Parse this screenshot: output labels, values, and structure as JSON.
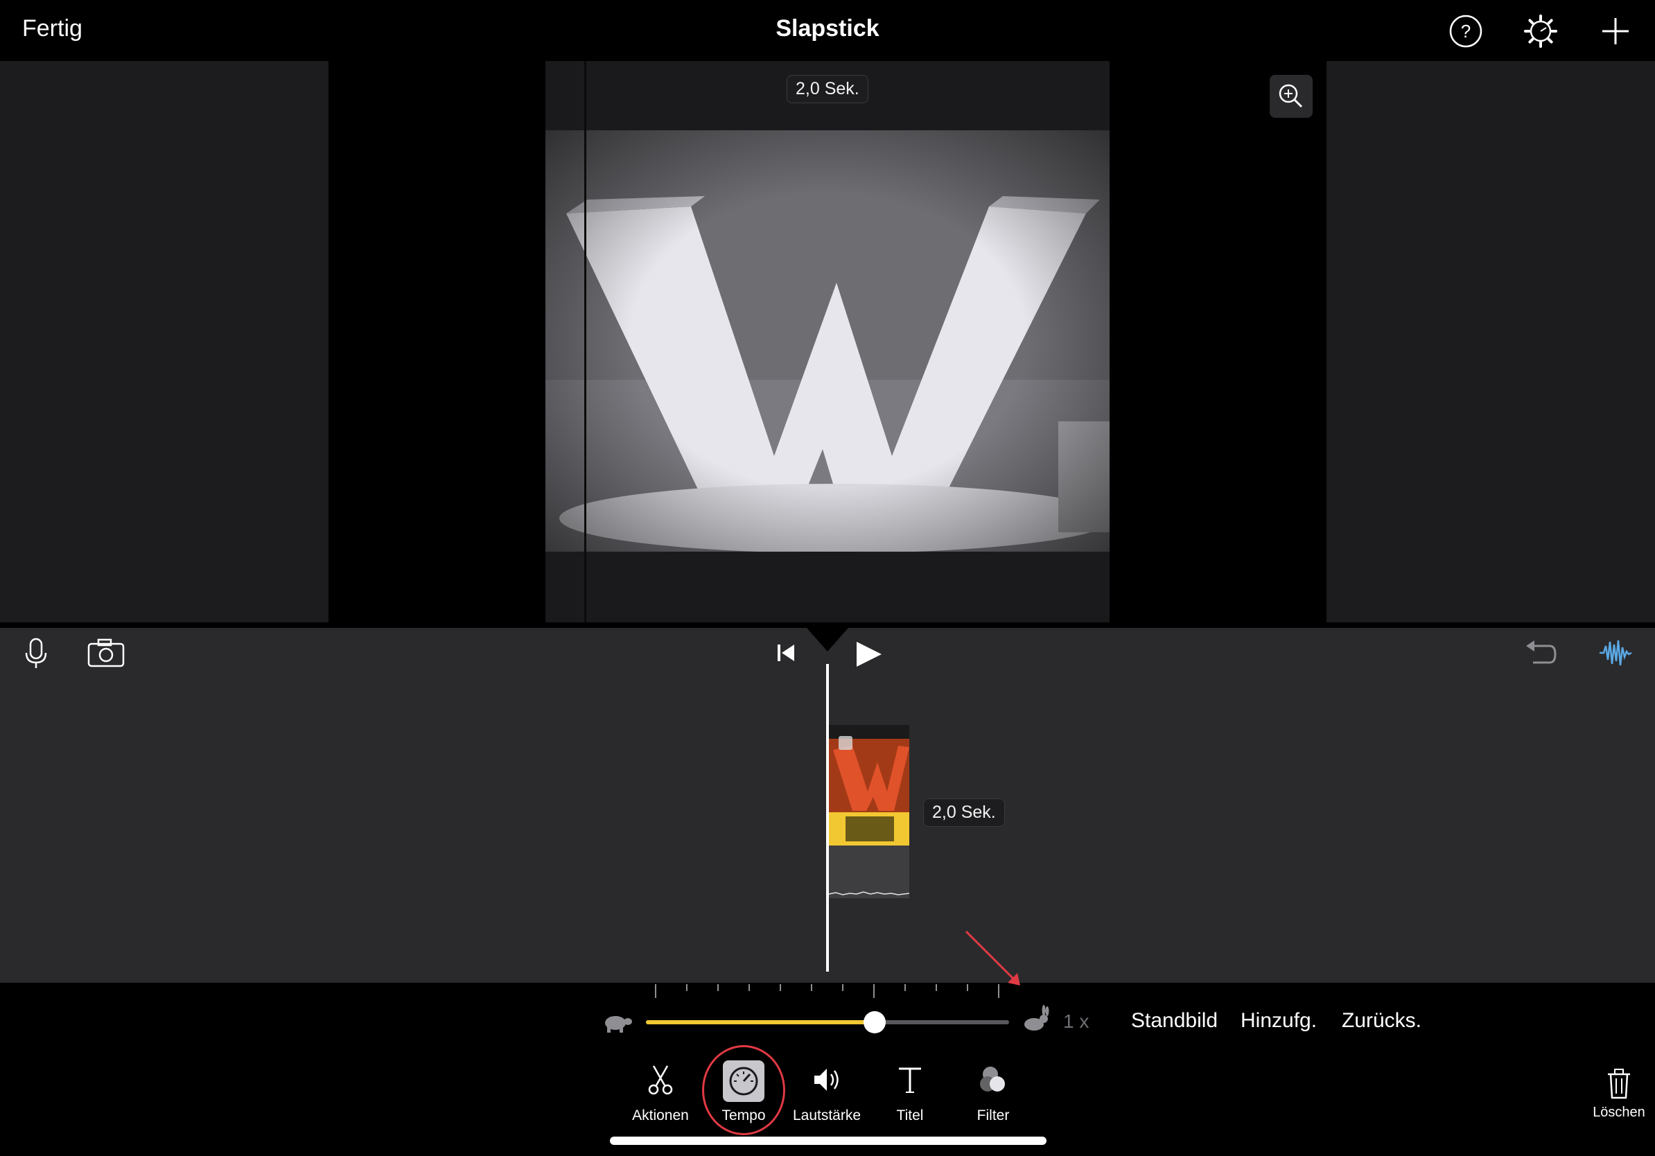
{
  "app": {
    "title": "Slapstick",
    "done_label": "Fertig"
  },
  "viewer": {
    "duration_badge": "2,0 Sek."
  },
  "timeline": {
    "clip_duration": "2,0 Sek."
  },
  "speed": {
    "value_label": "1 x",
    "slider_fraction": 0.63
  },
  "speed_actions": [
    {
      "label": "Standbild"
    },
    {
      "label": "Hinzufg."
    },
    {
      "label": "Zurücks."
    }
  ],
  "tools": [
    {
      "label": "Aktionen",
      "icon": "scissors-icon"
    },
    {
      "label": "Tempo",
      "icon": "speedometer-icon",
      "selected": true
    },
    {
      "label": "Lautstärke",
      "icon": "speaker-icon"
    },
    {
      "label": "Titel",
      "icon": "title-t-icon"
    },
    {
      "label": "Filter",
      "icon": "filter-circles-icon"
    }
  ],
  "delete_label": "Löschen",
  "colors": {
    "accent_yellow": "#f2c832",
    "annotation_red": "#e03a44",
    "waveform_blue": "#5aa9e6"
  }
}
